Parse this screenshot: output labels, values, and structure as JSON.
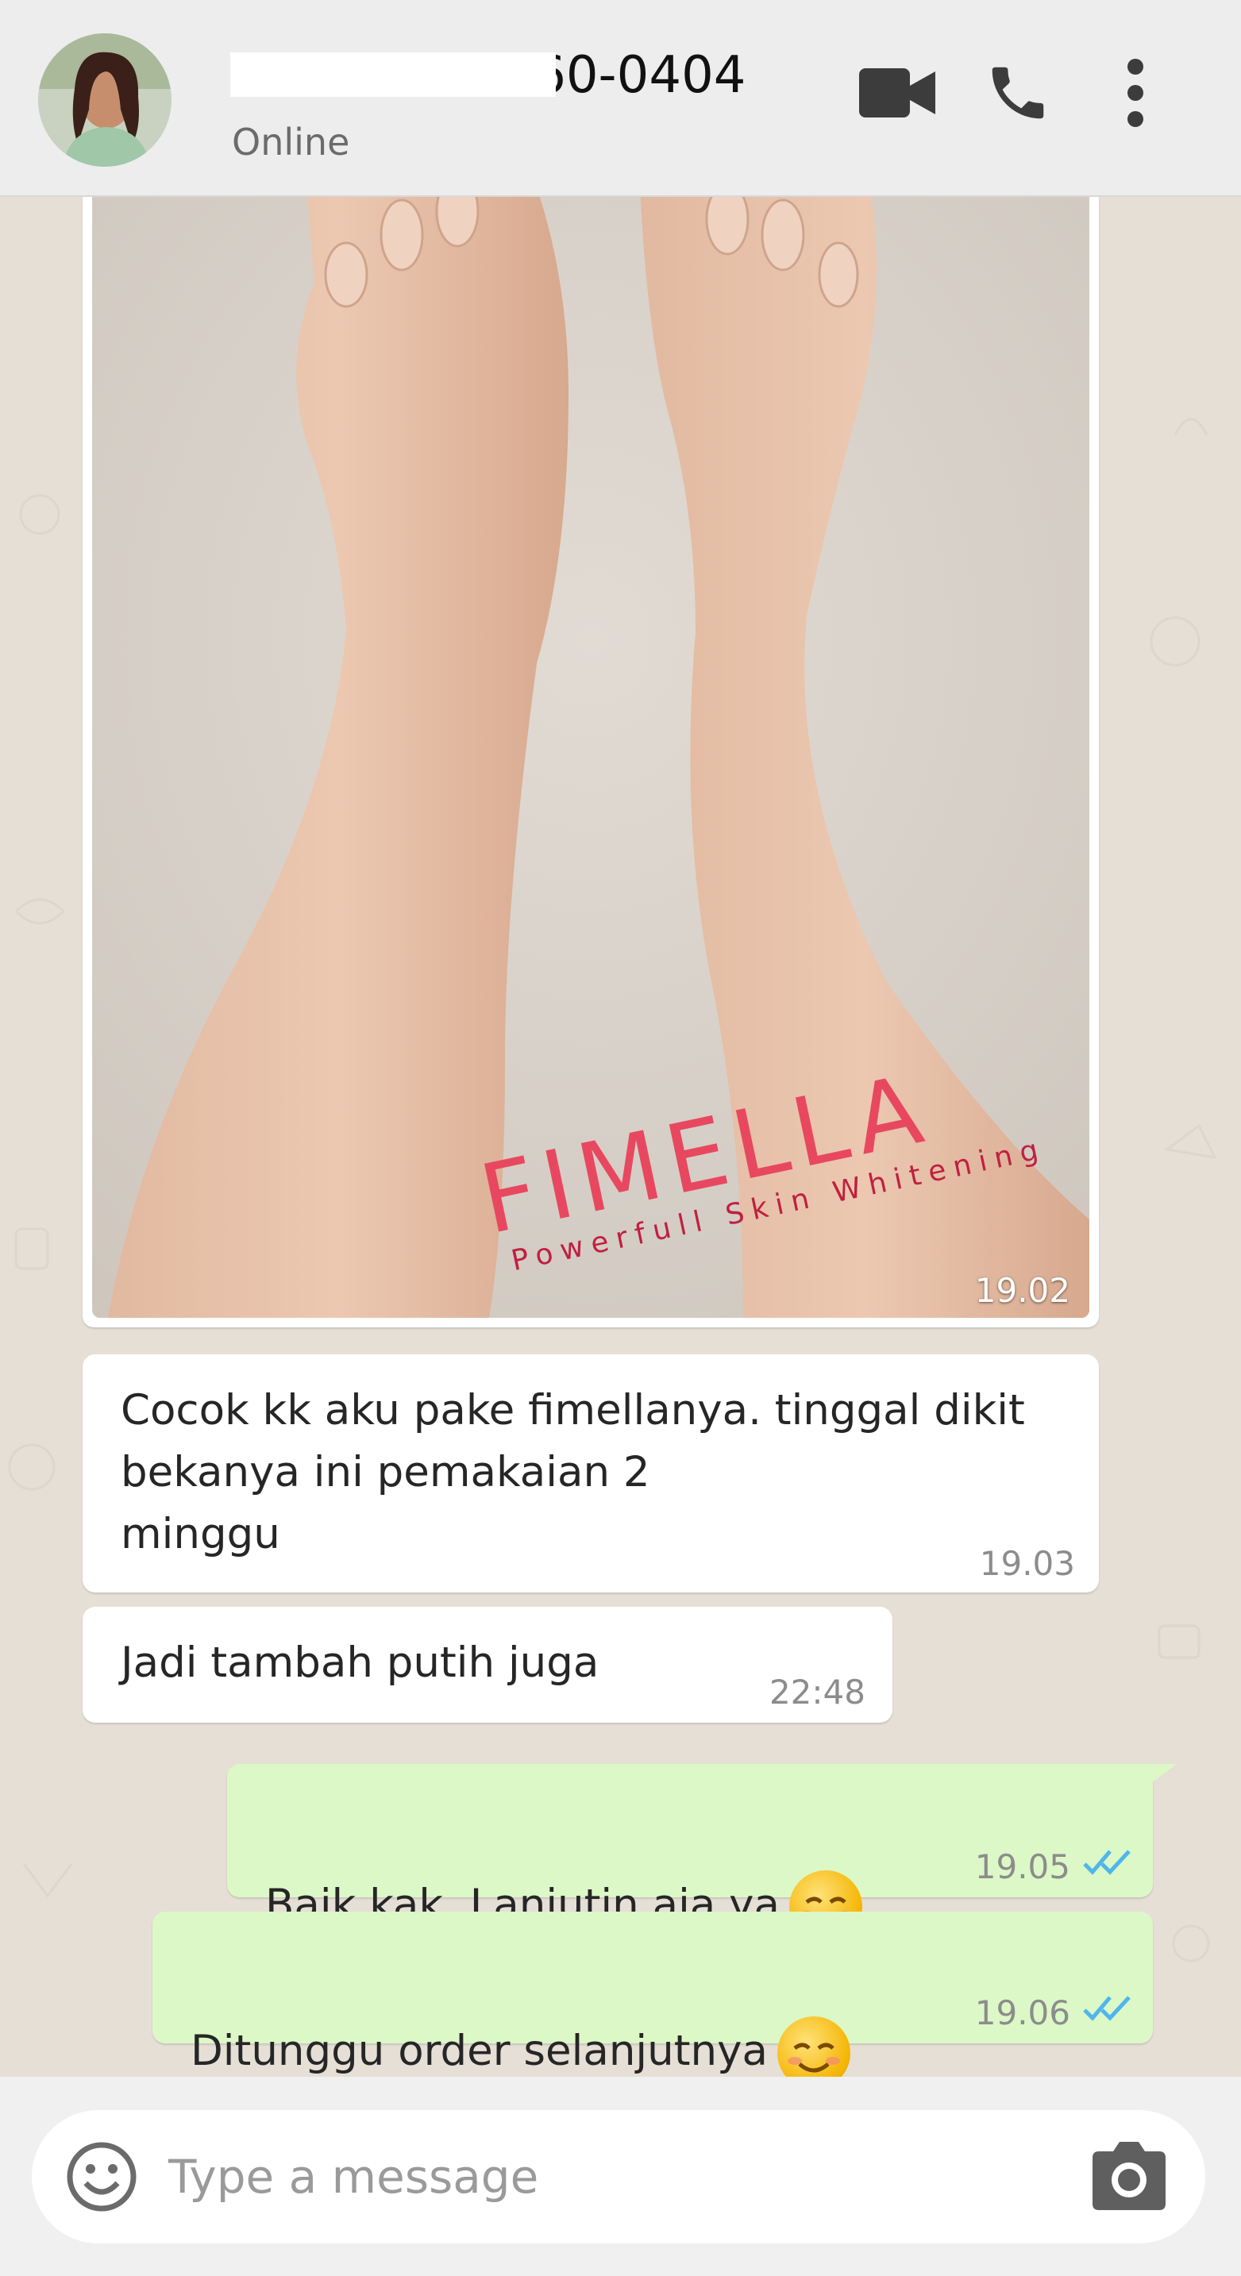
{
  "header": {
    "contact_name": "+62 812-8760-0404",
    "status": "Online"
  },
  "messages": [
    {
      "direction": "in",
      "type": "image",
      "time": "19.02",
      "watermark_brand": "FIMELLA",
      "watermark_tagline": "Powerfull Skin Whitening"
    },
    {
      "direction": "in",
      "type": "text",
      "text": "Cocok kk aku pake fimellanya. tinggal dikit\nbekanya ini pemakaian 2\nminggu",
      "time": "19.03"
    },
    {
      "direction": "in",
      "type": "text",
      "text": "Jadi tambah putih juga",
      "time": "22:48"
    },
    {
      "direction": "out",
      "type": "text",
      "text": "Baik kak. Lanjutin aja ya",
      "time": "19.05",
      "emoji": "smiling-face-icon"
    },
    {
      "direction": "out",
      "type": "text",
      "text": "Ditunggu order selanjutnya",
      "time": "19.06",
      "emoji": "smiling-face-icon"
    }
  ],
  "input": {
    "placeholder": "Type a message"
  },
  "icons": {
    "video": "video-call-icon",
    "call": "phone-icon",
    "menu": "more-vert-icon",
    "emoji": "emoji-icon",
    "camera": "camera-icon",
    "read": "double-check-icon"
  },
  "colors": {
    "incoming_bubble": "#ffffff",
    "outgoing_bubble": "#dcf8c6",
    "read_ticks": "#4fb6ec",
    "chat_background": "#e6dfd6",
    "header": "#ededed"
  }
}
